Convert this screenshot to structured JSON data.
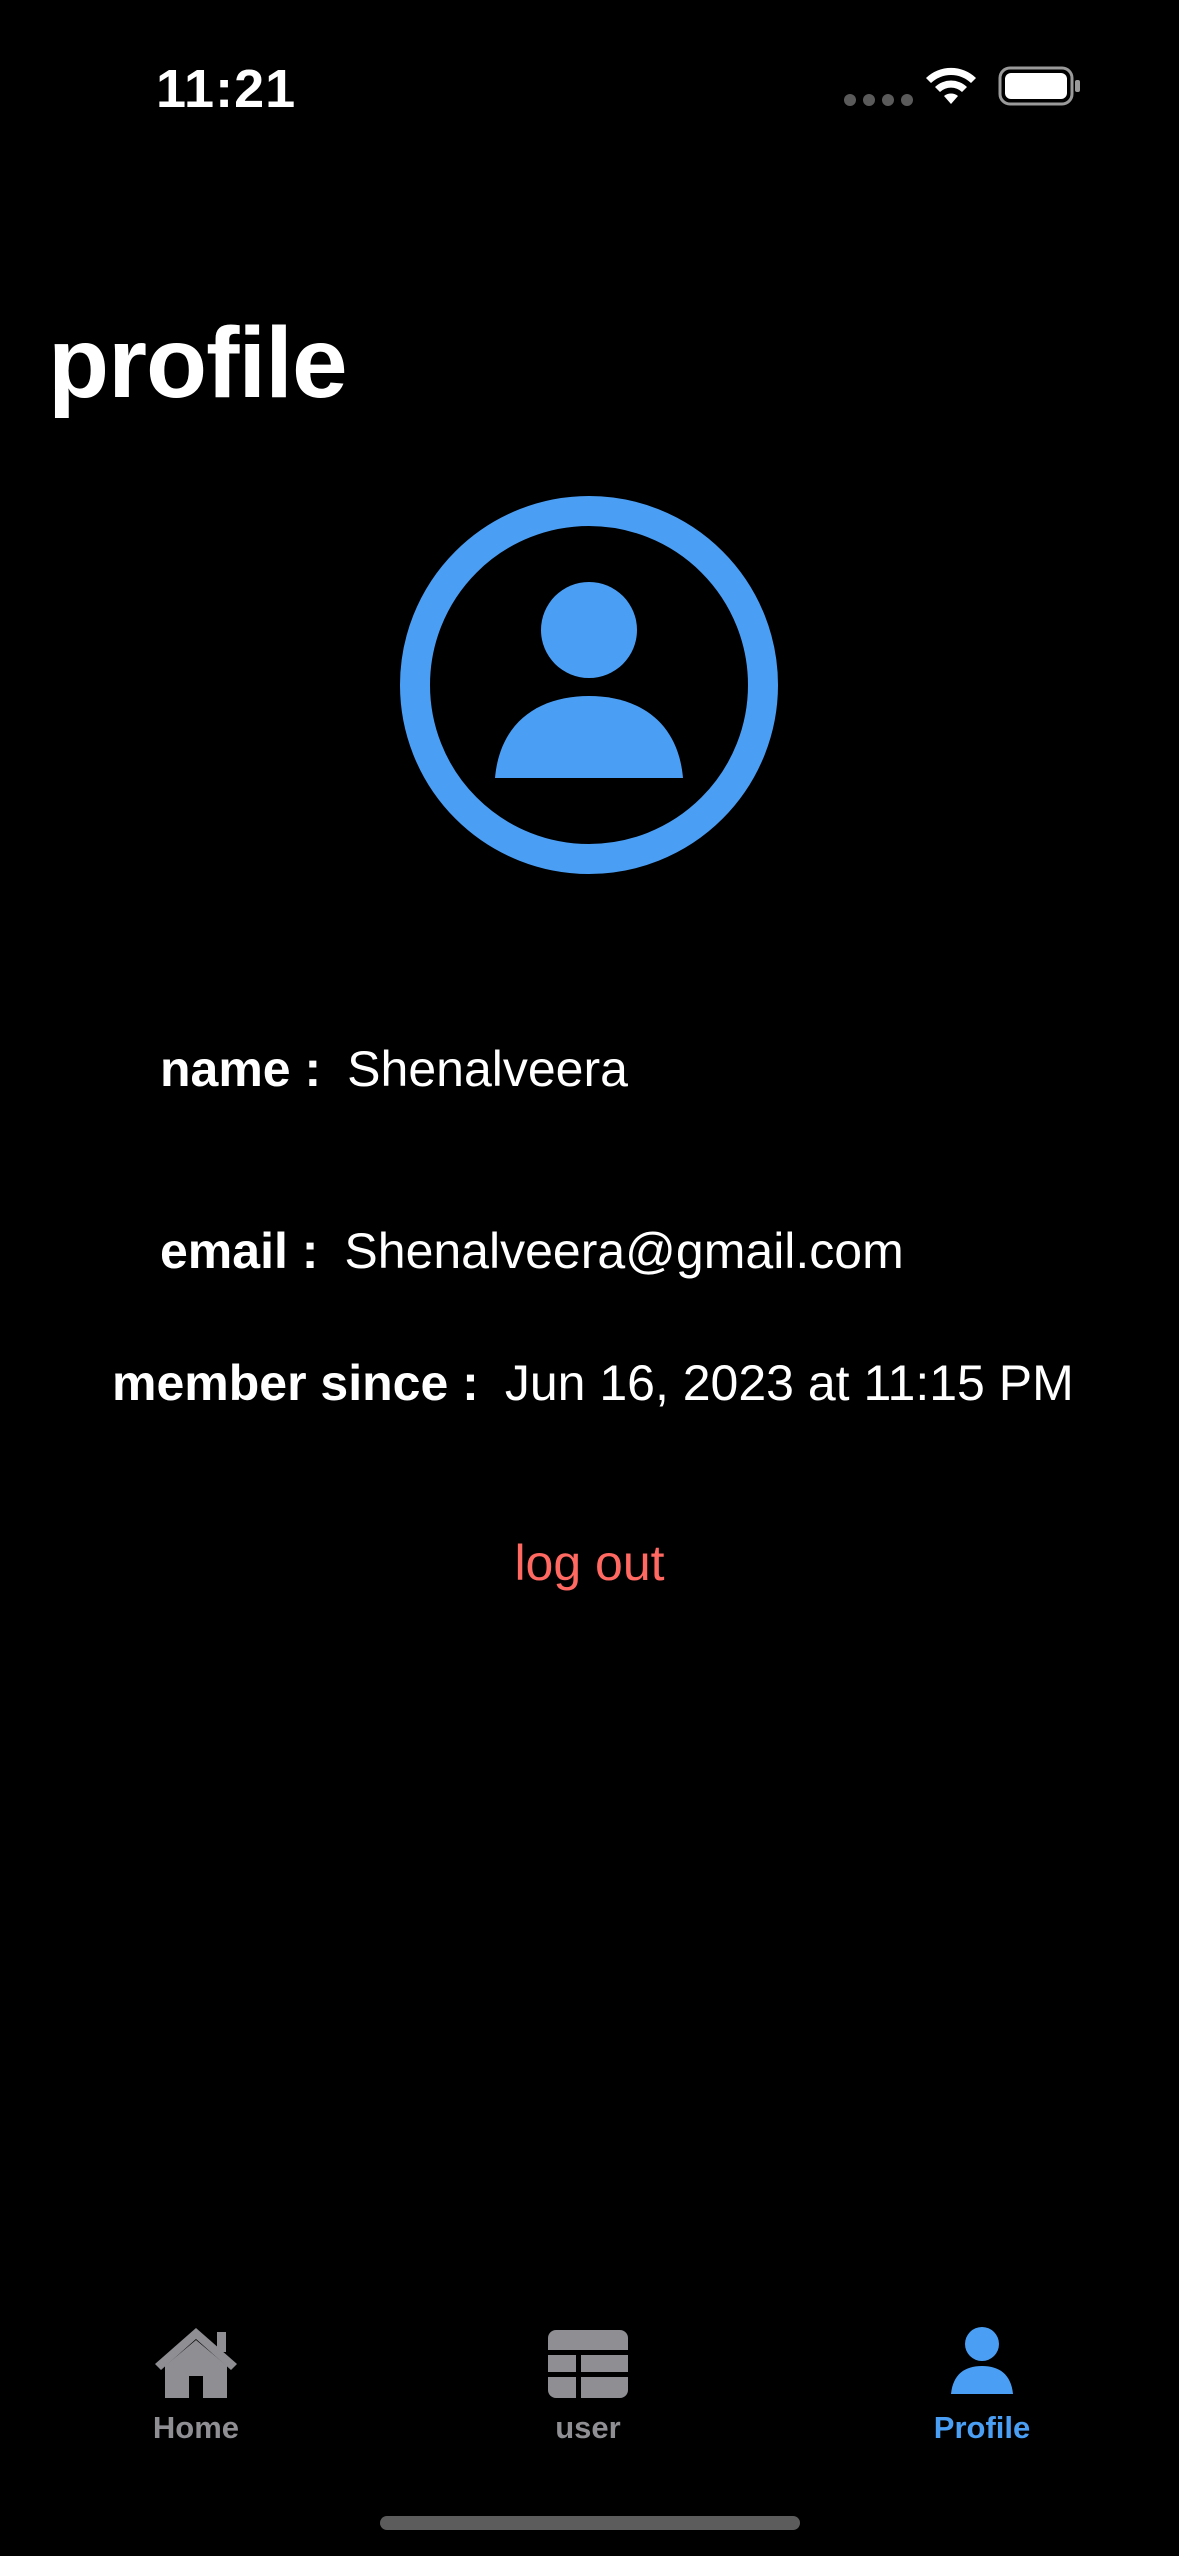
{
  "status_bar": {
    "time": "11:21",
    "wifi_icon": "wifi-icon",
    "battery_icon": "battery-icon",
    "signal_icon": "cellular-signal-icon"
  },
  "page": {
    "title": "profile"
  },
  "avatar": {
    "icon": "person-circle-icon",
    "color": "#4a9ff5"
  },
  "profile": {
    "name_label": "name :",
    "name_value": "Shenalveera",
    "email_label": "email :",
    "email_value": "Shenalveera@gmail.com",
    "member_label": "member since :",
    "member_value": "Jun 16, 2023 at 11:15 PM"
  },
  "actions": {
    "logout_label": "log out",
    "logout_color": "#ff6961"
  },
  "tab_bar": {
    "tabs": [
      {
        "label": "Home",
        "icon": "house-icon",
        "selected": false
      },
      {
        "label": "user",
        "icon": "table-icon",
        "selected": false
      },
      {
        "label": "Profile",
        "icon": "person-icon",
        "selected": true
      }
    ],
    "selected_color": "#4a9ff5",
    "unselected_color": "#8e8e93"
  }
}
